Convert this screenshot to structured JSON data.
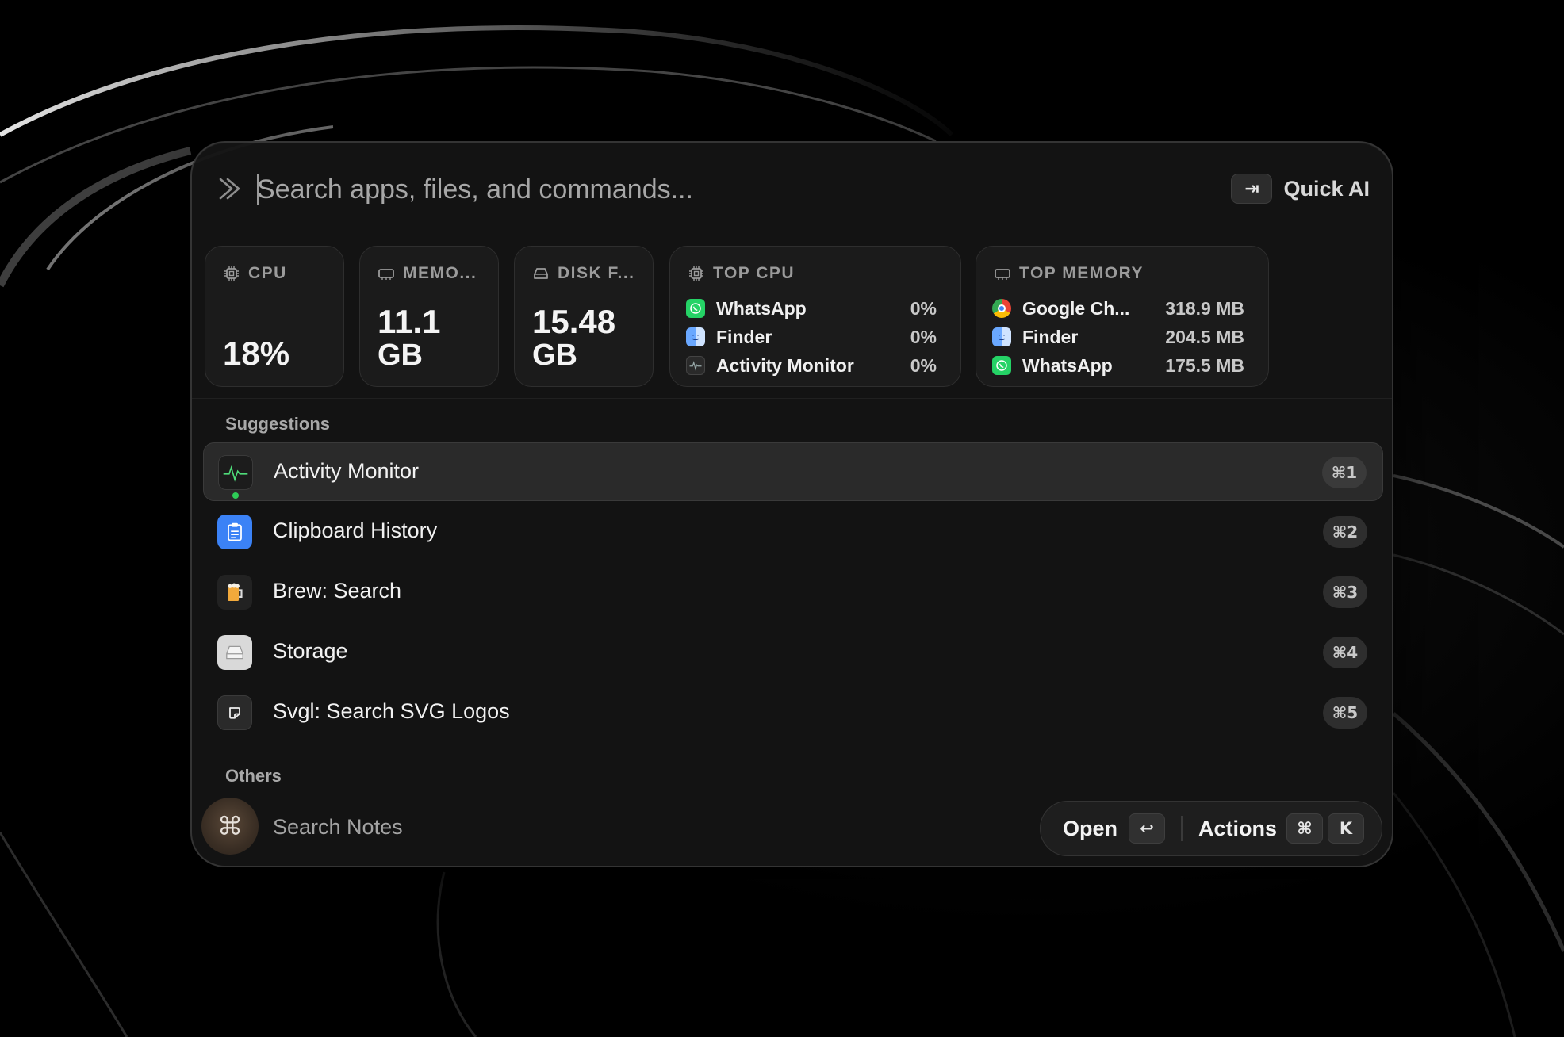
{
  "search": {
    "placeholder": "Search apps, files, and commands...",
    "quick_ai_key": "⇥",
    "quick_ai_label": "Quick AI"
  },
  "stats": {
    "cpu": {
      "title": "CPU",
      "value": "18%"
    },
    "memory": {
      "title": "MEMO...",
      "value_line1": "11.1",
      "value_line2": "GB"
    },
    "disk": {
      "title": "DISK F...",
      "value_line1": "15.48",
      "value_line2": "GB"
    },
    "top_cpu": {
      "title": "TOP CPU",
      "items": [
        {
          "name": "WhatsApp",
          "value": "0%",
          "icon": "whatsapp-icon"
        },
        {
          "name": "Finder",
          "value": "0%",
          "icon": "finder-icon"
        },
        {
          "name": "Activity Monitor",
          "value": "0%",
          "icon": "activity-monitor-icon"
        }
      ]
    },
    "top_memory": {
      "title": "TOP MEMORY",
      "items": [
        {
          "name": "Google Ch...",
          "value": "318.9 MB",
          "icon": "chrome-icon"
        },
        {
          "name": "Finder",
          "value": "204.5 MB",
          "icon": "finder-icon"
        },
        {
          "name": "WhatsApp",
          "value": "175.5 MB",
          "icon": "whatsapp-icon"
        }
      ]
    }
  },
  "suggestions": {
    "label": "Suggestions",
    "items": [
      {
        "label": "Activity Monitor",
        "shortcut": "⌘1",
        "icon": "activity-monitor-icon",
        "selected": true
      },
      {
        "label": "Clipboard History",
        "shortcut": "⌘2",
        "icon": "clipboard-icon"
      },
      {
        "label": "Brew: Search",
        "shortcut": "⌘3",
        "icon": "beer-mug-icon"
      },
      {
        "label": "Storage",
        "shortcut": "⌘4",
        "icon": "storage-drive-icon"
      },
      {
        "label": "Svgl: Search SVG Logos",
        "shortcut": "⌘5",
        "icon": "svgl-icon"
      }
    ]
  },
  "others": {
    "label": "Others",
    "items": [
      {
        "label": "Search Notes",
        "icon": "command-icon",
        "glyph": "⌘"
      }
    ]
  },
  "action_bar": {
    "open_label": "Open",
    "open_key": "↩",
    "actions_label": "Actions",
    "actions_keys": [
      "⌘",
      "K"
    ]
  },
  "colors": {
    "accent_green": "#2ecc57",
    "clipboard_blue": "#3b82f6",
    "whatsapp_green": "#25d366",
    "finder_blue": "#4a90f5"
  }
}
